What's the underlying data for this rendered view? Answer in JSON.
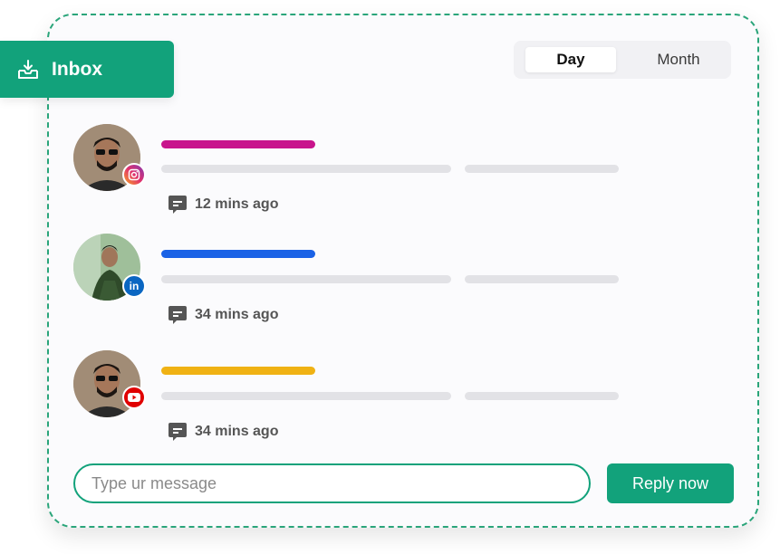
{
  "inbox": {
    "label": "Inbox",
    "icon": "inbox-tray-icon"
  },
  "period_toggle": {
    "options": [
      "Day",
      "Month"
    ],
    "selected": "Day"
  },
  "messages": [
    {
      "platform": "Instagram",
      "platform_icon": "instagram-icon",
      "accent_color": "#c8148c",
      "time": "12 mins ago"
    },
    {
      "platform": "LinkedIn",
      "platform_icon": "linkedin-icon",
      "accent_color": "#1a62e6",
      "time": "34 mins ago"
    },
    {
      "platform": "YouTube",
      "platform_icon": "youtube-icon",
      "accent_color": "#f0b214",
      "time": "34 mins ago"
    }
  ],
  "composer": {
    "placeholder": "Type ur message",
    "value": "",
    "reply_label": "Reply now"
  },
  "colors": {
    "brand": "#12a27b",
    "border_dashed": "#2aa57a",
    "skeleton": "#e2e2e6"
  }
}
